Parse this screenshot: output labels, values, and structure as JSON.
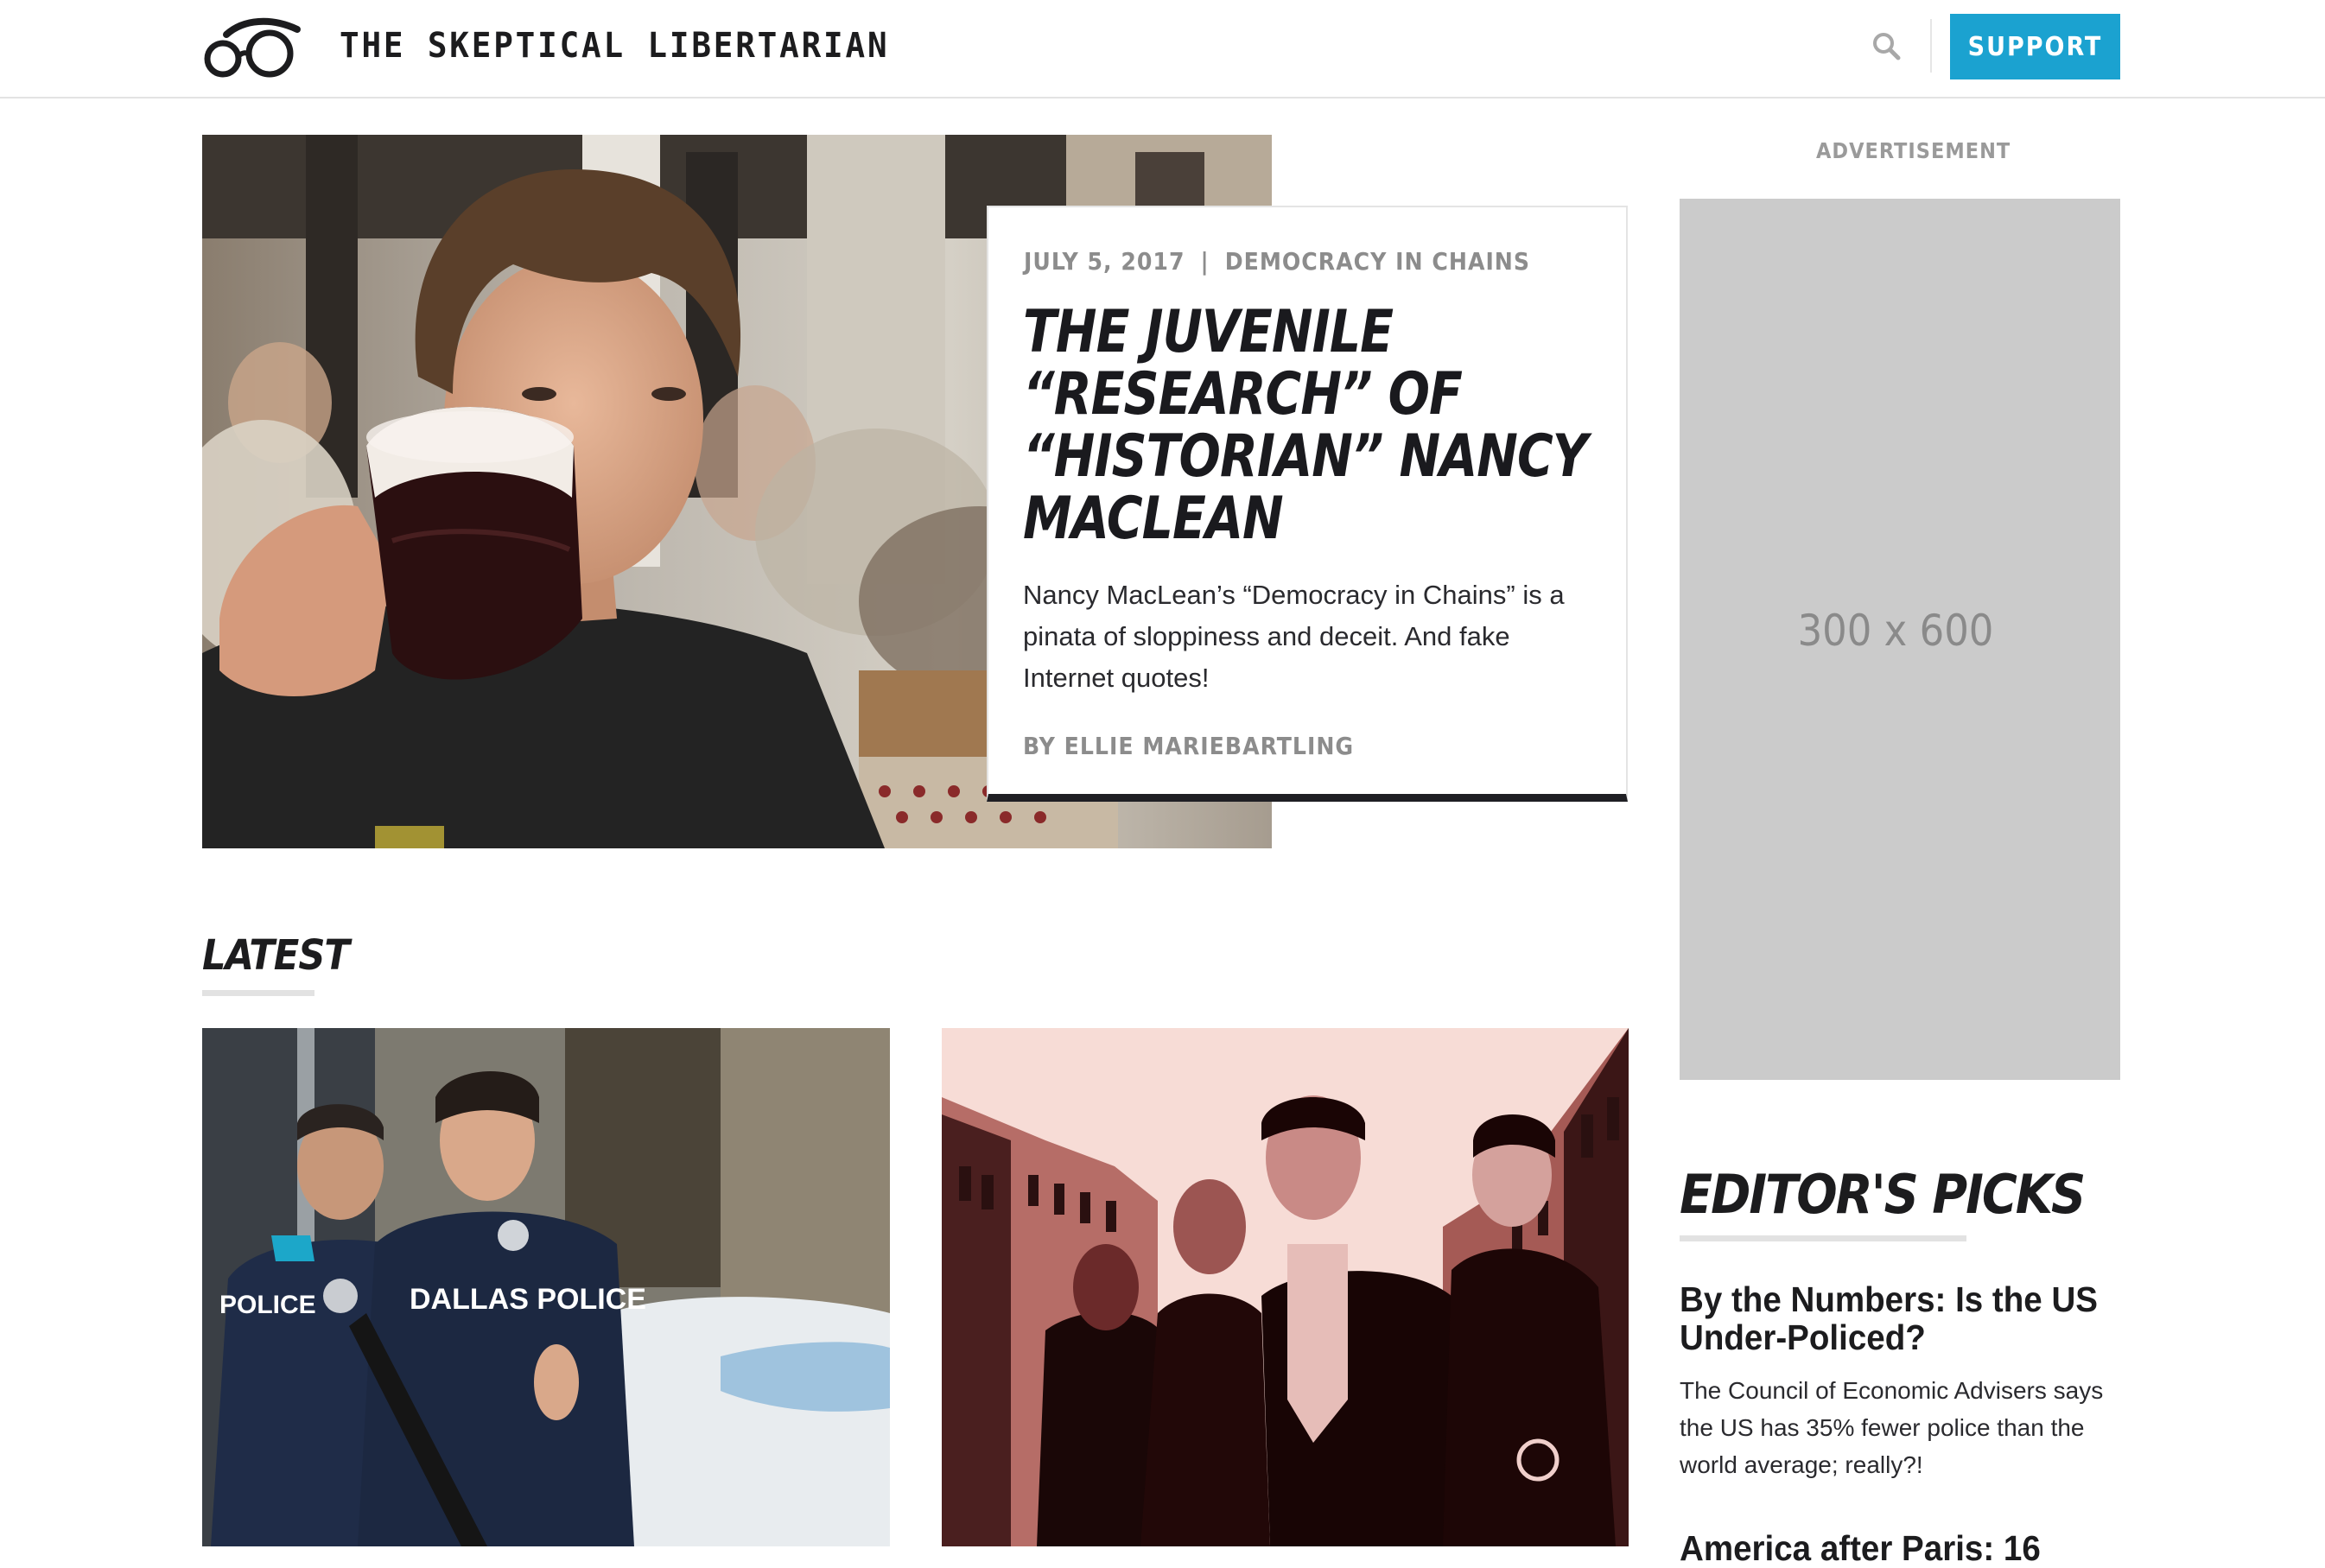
{
  "header": {
    "site_title": "THE SKEPTICAL LIBERTARIAN",
    "support_label": "SUPPORT",
    "accent_color": "#1ba2d0",
    "logo_icon": "glasses-icon",
    "search_icon": "search-icon"
  },
  "hero": {
    "date": "JULY 5, 2017",
    "separator": "|",
    "category": "DEMOCRACY IN CHAINS",
    "title": "THE JUVENILE “RESEARCH” OF “HISTORIAN” NANCY MACLEAN",
    "excerpt": "Nancy MacLean’s “Democracy in Chains” is a pinata of sloppiness and deceit. And fake Internet quotes!",
    "byline_prefix": "BY ",
    "author": "ELLIE MARIEBARTLING"
  },
  "latest": {
    "heading": "LATEST",
    "cards": [
      {
        "image_badge_left": "POLICE",
        "image_badge_right": "DALLAS POLICE"
      },
      {
        "image": "red-toned-group"
      }
    ]
  },
  "sidebar": {
    "ad_label": "ADVERTISEMENT",
    "ad_size": "300 x 600",
    "picks_heading": "EDITOR'S PICKS",
    "picks": [
      {
        "title": "By the Numbers: Is the US Under-Policed?",
        "excerpt": "The Council of Economic Advisers says the US has 35% fewer police than the world average; really?!"
      },
      {
        "title": "America after Paris: 16"
      }
    ]
  }
}
